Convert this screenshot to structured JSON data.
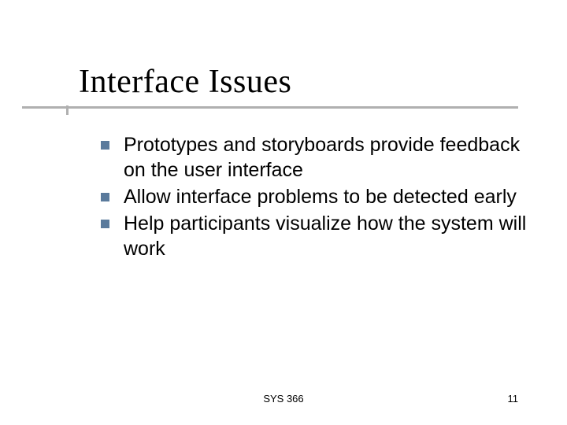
{
  "title": "Interface Issues",
  "bullets": [
    "Prototypes and storyboards provide feedback on the user interface",
    "Allow interface problems to be detected early",
    "Help participants visualize how the system will work"
  ],
  "footer": {
    "center": "SYS 366",
    "page_number": "11"
  },
  "colors": {
    "bullet": "#5a7a9c",
    "underline": "#b0b0b0"
  }
}
